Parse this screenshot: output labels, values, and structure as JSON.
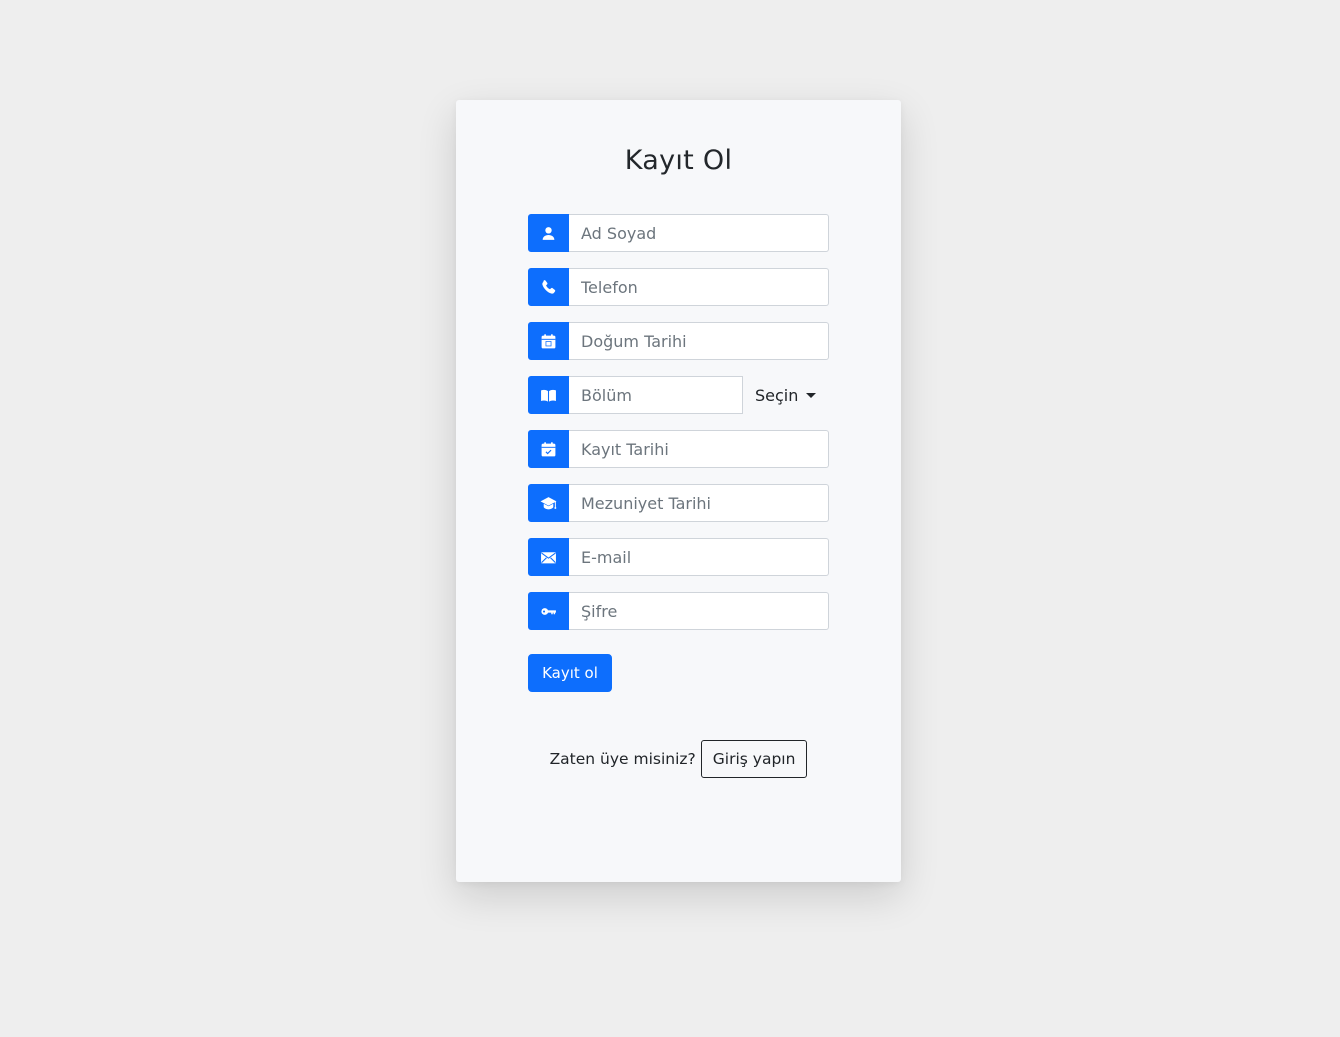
{
  "form": {
    "title": "Kayıt Ol",
    "fields": [
      {
        "placeholder": "Ad Soyad",
        "icon": "person-icon"
      },
      {
        "placeholder": "Telefon",
        "icon": "phone-icon"
      },
      {
        "placeholder": "Doğum Tarihi",
        "icon": "calendar-icon"
      },
      {
        "placeholder": "Bölüm",
        "icon": "book-icon"
      },
      {
        "placeholder": "Kayıt Tarihi",
        "icon": "calendar-check-icon"
      },
      {
        "placeholder": "Mezuniyet Tarihi",
        "icon": "graduation-cap-icon"
      },
      {
        "placeholder": "E-mail",
        "icon": "envelope-icon"
      },
      {
        "placeholder": "Şifre",
        "icon": "key-icon"
      }
    ],
    "department_dropdown_label": "Seçin",
    "submit_label": "Kayıt ol"
  },
  "footer": {
    "prompt": "Zaten üye misiniz?",
    "login_label": "Giriş yapın"
  },
  "colors": {
    "primary": "#0d6efd",
    "page_background": "#eeeeee",
    "card_background": "#f7f8fa"
  }
}
